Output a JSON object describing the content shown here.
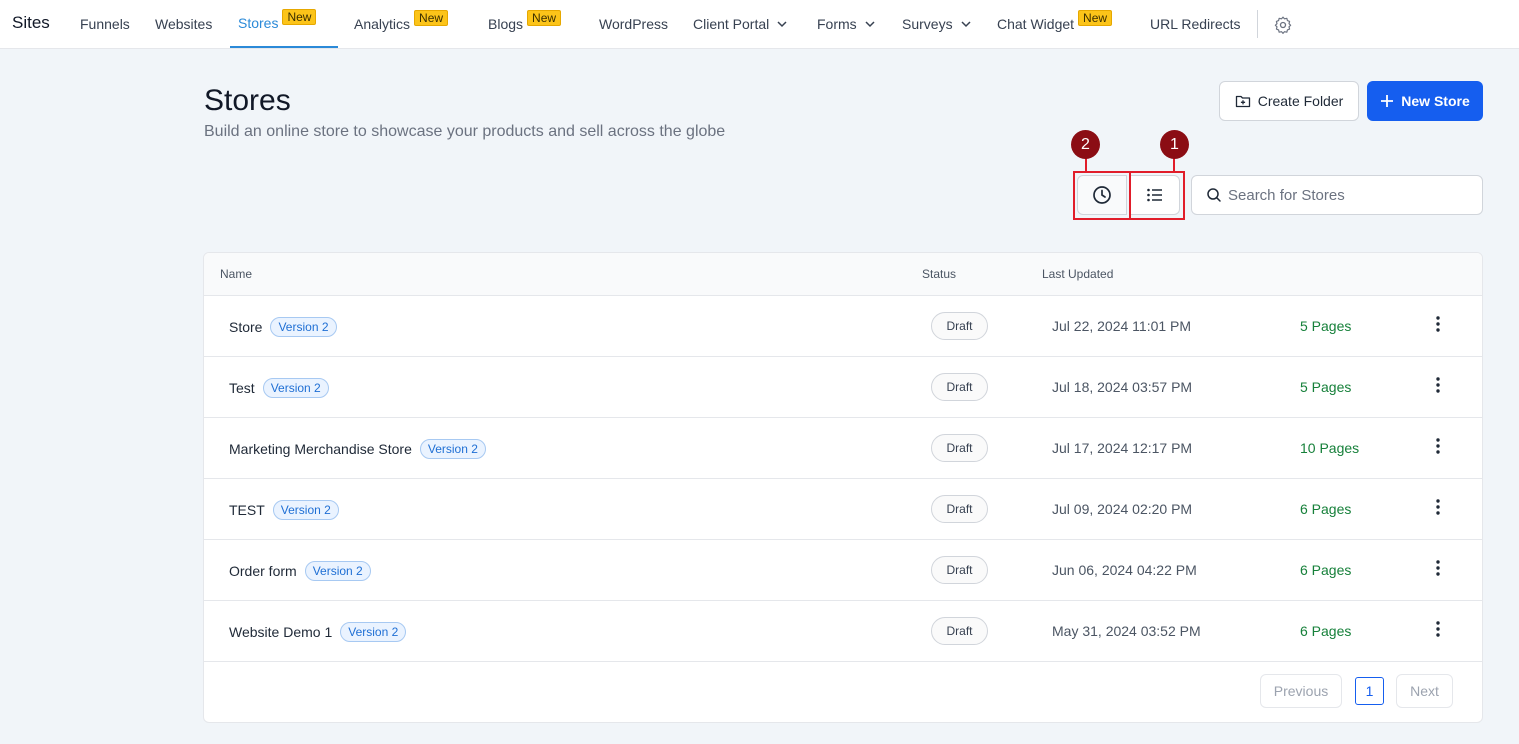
{
  "nav": {
    "brand": "Sites",
    "items": [
      {
        "label": "Funnels"
      },
      {
        "label": "Websites"
      },
      {
        "label": "Stores",
        "badge": "New"
      },
      {
        "label": "Analytics",
        "badge": "New"
      },
      {
        "label": "Blogs",
        "badge": "New"
      },
      {
        "label": "WordPress"
      },
      {
        "label": "Client Portal"
      },
      {
        "label": "Forms"
      },
      {
        "label": "Surveys"
      },
      {
        "label": "Chat Widget",
        "badge": "New"
      },
      {
        "label": "URL Redirects"
      }
    ],
    "settings_icon": "gear-icon"
  },
  "header": {
    "title": "Stores",
    "subtitle": "Build an online store to showcase your products and sell across the globe",
    "create_folder_label": "Create Folder",
    "new_store_label": "New Store"
  },
  "annotations": {
    "one": "1",
    "two": "2",
    "color": "#e11d2a"
  },
  "search": {
    "placeholder": "Search for Stores"
  },
  "table": {
    "columns": {
      "name": "Name",
      "status": "Status",
      "updated": "Last Updated"
    },
    "rows": [
      {
        "name": "Store",
        "version": "Version 2",
        "status": "Draft",
        "updated": "Jul 22, 2024 11:01 PM",
        "pages": "5 Pages"
      },
      {
        "name": "Test",
        "version": "Version 2",
        "status": "Draft",
        "updated": "Jul 18, 2024 03:57 PM",
        "pages": "5 Pages"
      },
      {
        "name": "Marketing Merchandise Store",
        "version": "Version 2",
        "status": "Draft",
        "updated": "Jul 17, 2024 12:17 PM",
        "pages": "10 Pages"
      },
      {
        "name": "TEST",
        "version": "Version 2",
        "status": "Draft",
        "updated": "Jul 09, 2024 02:20 PM",
        "pages": "6 Pages"
      },
      {
        "name": "Order form",
        "version": "Version 2",
        "status": "Draft",
        "updated": "Jun 06, 2024 04:22 PM",
        "pages": "6 Pages"
      },
      {
        "name": "Website Demo 1",
        "version": "Version 2",
        "status": "Draft",
        "updated": "May 31, 2024 03:52 PM",
        "pages": "6 Pages"
      }
    ]
  },
  "pagination": {
    "previous": "Previous",
    "current": "1",
    "next": "Next"
  },
  "colors": {
    "accent": "#2b8ad8",
    "primary_button": "#155eef",
    "pages_green": "#16803a",
    "new_badge": "#fcc419"
  }
}
